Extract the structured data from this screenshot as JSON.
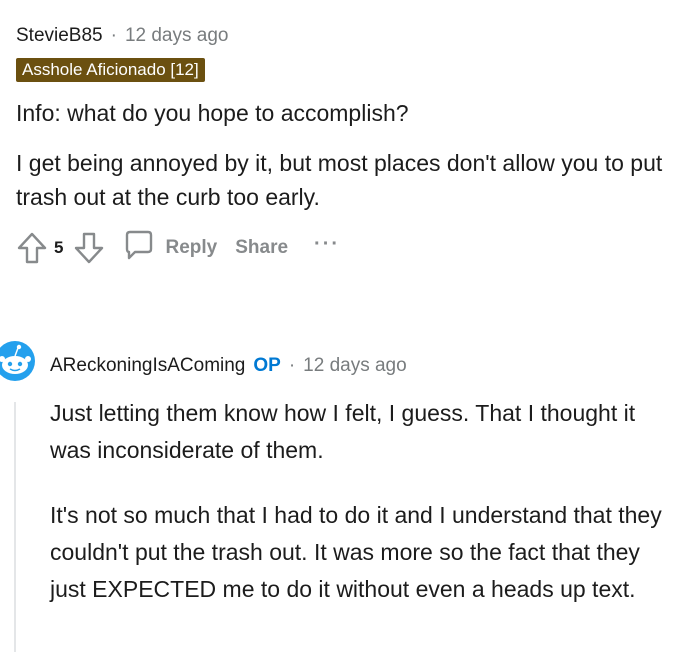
{
  "comment": {
    "username": "StevieB85",
    "separator": "·",
    "timestamp": "12 days ago",
    "flair": "Asshole Aficionado [12]",
    "paragraphs": [
      "Info: what do you hope to accomplish?",
      "I get being annoyed by it, but most places don't allow you to put trash out at the curb too early."
    ],
    "vote_count": "5",
    "actions": {
      "reply_label": "Reply",
      "share_label": "Share",
      "more_label": "···"
    }
  },
  "reply": {
    "username": "AReckoningIsAComing",
    "op_badge": "OP",
    "separator": "·",
    "timestamp": "12 days ago",
    "paragraphs": [
      "Just letting them know how I felt, I guess. That I thought it was inconsiderate of them.",
      "It's not so much that I had to do it and I understand that they couldn't put the trash out. It was more so the fact that they just EXPECTED me to do it without even a heads up text."
    ]
  },
  "colors": {
    "flair_bg": "#6b5010",
    "op_badge": "#0079d3",
    "muted": "#787c7e",
    "avatar_blue": "#24a0ed"
  }
}
